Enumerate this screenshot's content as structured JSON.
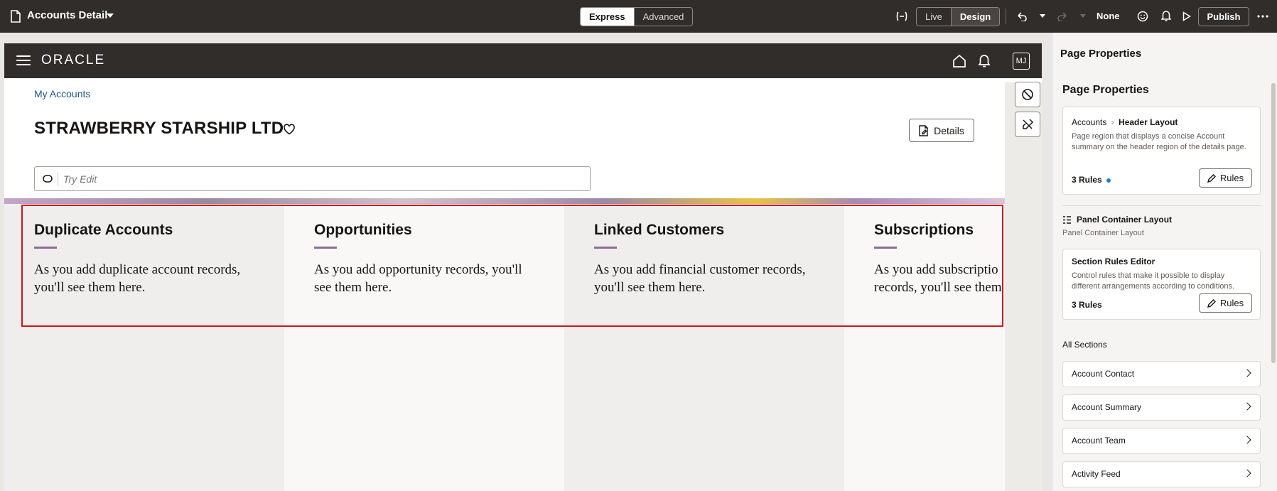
{
  "toolbar": {
    "title": "Accounts Detail",
    "mode_express": "Express",
    "mode_advanced": "Advanced",
    "view_live": "Live",
    "view_design": "Design",
    "sandbox_label": "None",
    "publish_label": "Publish"
  },
  "app": {
    "logo": "ORACLE",
    "avatar_initials": "MJ",
    "breadcrumb": "My Accounts",
    "account_name": "STRAWBERRY STARSHIP LTD",
    "details_label": "Details",
    "try_edit_placeholder": "Try Edit"
  },
  "panels": [
    {
      "title": "Duplicate Accounts",
      "body_line1": "As you add duplicate account records,",
      "body_line2": "you'll see them here."
    },
    {
      "title": "Opportunities",
      "body_line1": "As you add opportunity records, you'll",
      "body_line2": "see them here."
    },
    {
      "title": "Linked Customers",
      "body_line1": "As you add financial customer records,",
      "body_line2": "you'll see them here."
    },
    {
      "title": "Subscriptions",
      "body_line1": "As you add subscriptio",
      "body_line2": "records, you'll see them"
    }
  ],
  "properties": {
    "pane_title": "Page Properties",
    "section_title": "Page Properties",
    "header_card": {
      "crumb_parent": "Accounts",
      "crumb_current": "Header Layout",
      "description": "Page region that displays a concise Account summary on the header region of the details page.",
      "rules_count": "3 Rules",
      "rules_button": "Rules"
    },
    "panel_container": {
      "title": "Panel Container Layout",
      "subtitle": "Panel Container Layout"
    },
    "section_rules_card": {
      "title": "Section Rules Editor",
      "description": "Control rules that make it possible to display different arrangements according to conditions.",
      "rules_count": "3 Rules",
      "rules_button": "Rules"
    },
    "all_sections_label": "All Sections",
    "sections": [
      {
        "label": "Account Contact"
      },
      {
        "label": "Account Summary"
      },
      {
        "label": "Account Team"
      },
      {
        "label": "Activity Feed"
      }
    ]
  },
  "colors": {
    "header_bg": "#312d2a",
    "accent_underline": "#8a6f95",
    "highlight_frame": "#d5121e",
    "link": "#1f5a86",
    "status_dot": "#227ecf"
  }
}
